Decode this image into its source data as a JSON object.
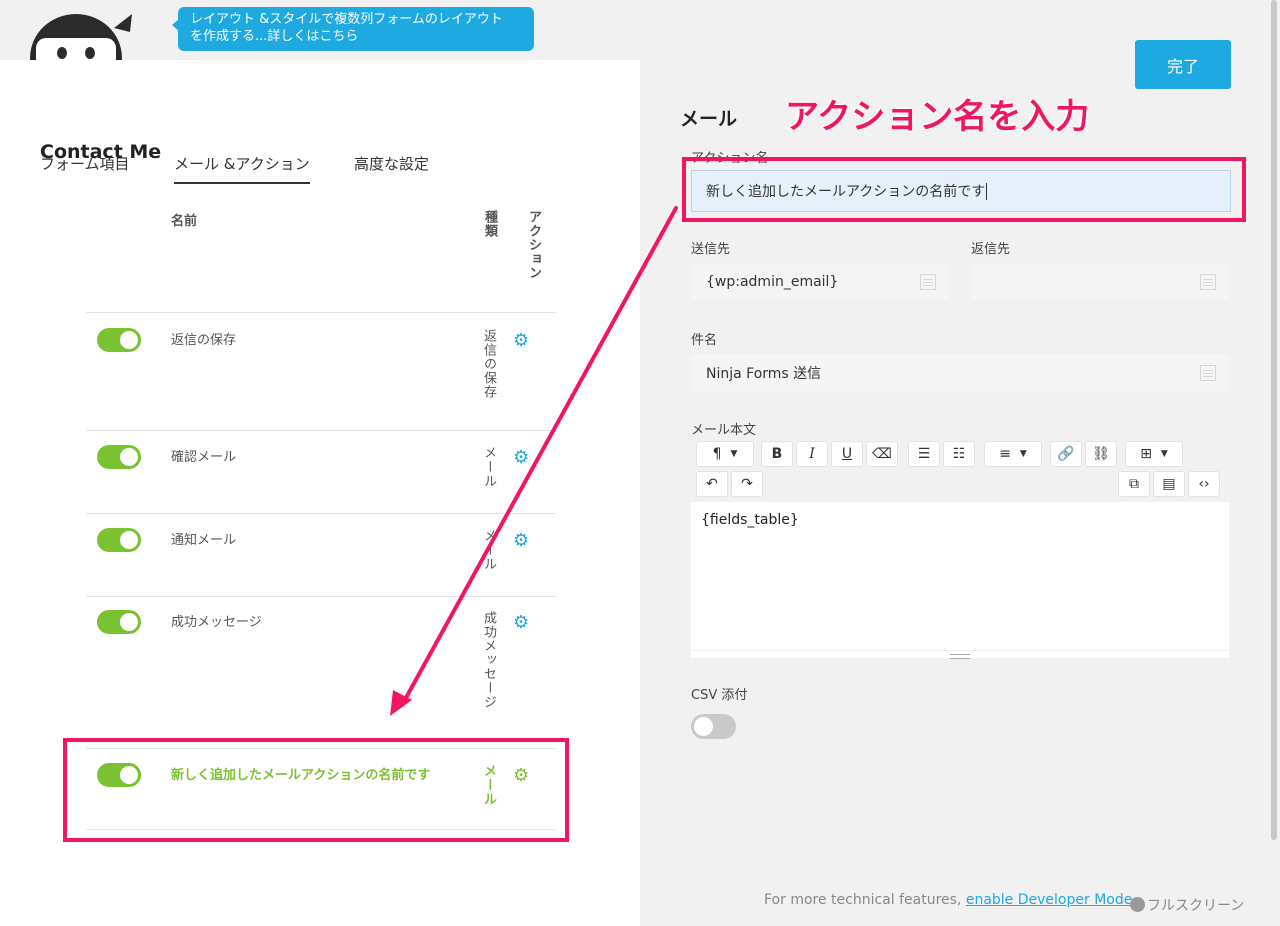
{
  "tooltip": {
    "line1": "レイアウト &スタイルで複数列フォームのレイアウト",
    "line2": "を作成する...詳しくはこちら"
  },
  "tabs": [
    {
      "label": "フォーム項目"
    },
    {
      "label": "メール &アクション"
    },
    {
      "label": "高度な設定"
    }
  ],
  "form_title": "Contact Me",
  "table": {
    "col_name": "名前",
    "col_type": "種類",
    "col_action": "アクション",
    "rows": [
      {
        "name": "返信の保存",
        "type": "返信の保存"
      },
      {
        "name": "確認メール",
        "type": "メール"
      },
      {
        "name": "通知メール",
        "type": "メール"
      },
      {
        "name": "成功メッセージ",
        "type": "成功メッセージ"
      },
      {
        "name": "新しく追加したメールアクションの名前です",
        "type": "メール"
      }
    ]
  },
  "done_button": "完了",
  "section_title": "メール",
  "annotation": "アクション名を入力",
  "fields": {
    "action_name_label": "アクション名",
    "action_name_value": "新しく追加したメールアクションの名前です",
    "to_label": "送信先",
    "to_value": "{wp:admin_email}",
    "reply_to_label": "返信先",
    "reply_to_value": "",
    "subject_label": "件名",
    "subject_value": "Ninja Forms 送信",
    "body_label": "メール本文",
    "body_value": "{fields_table}",
    "csv_label": "CSV 添付"
  },
  "footer": {
    "text": "For more technical features, ",
    "link": "enable Developer Mode",
    "fullscreen": "フルスクリーン"
  },
  "colors": {
    "accent": "#1ea9e1",
    "toggle_on": "#7ac231",
    "highlight": "#f2165e"
  }
}
